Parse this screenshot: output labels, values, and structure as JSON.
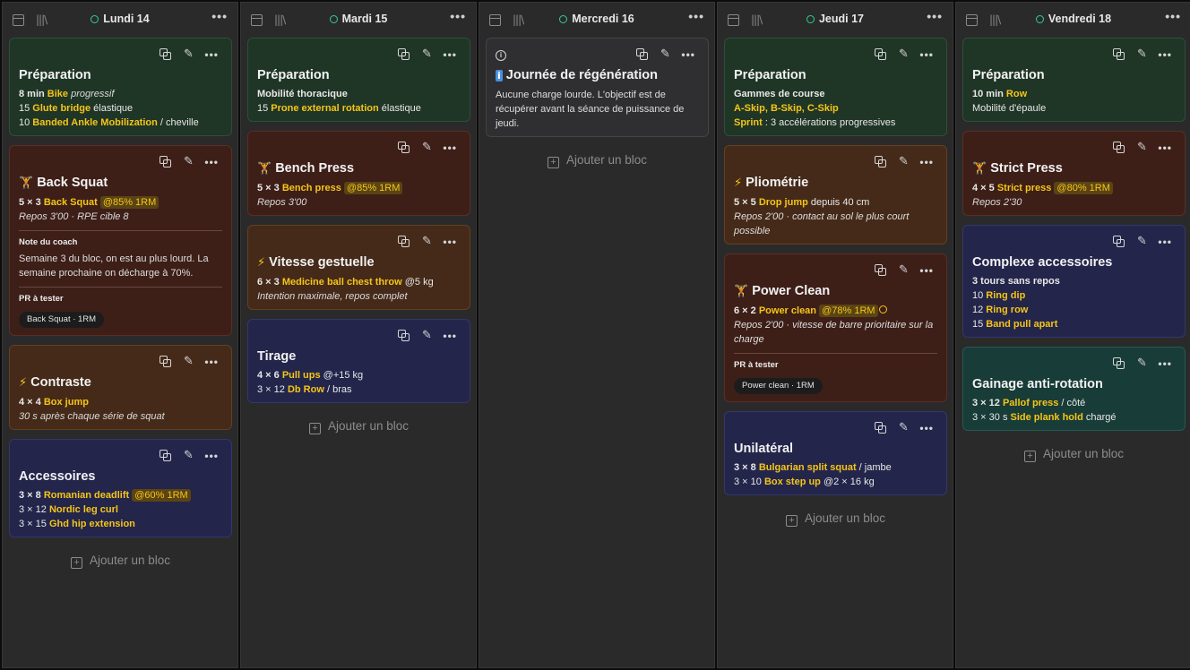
{
  "add_block_label": "Ajouter un bloc",
  "pr_label": "PR à tester",
  "coach_note_label": "Note du coach",
  "colors": {
    "green": "#1f3526",
    "red": "#3d1f18",
    "orange": "#452a19",
    "navy": "#23254b",
    "teal": "#183c37",
    "accent": "#f5c518",
    "status_dot": "#2fd08a"
  },
  "days": [
    {
      "label": "Lundi 14",
      "cards": [
        {
          "color": "green",
          "title": "Préparation",
          "lines": [
            [
              {
                "t": "8 min ",
                "s": "b"
              },
              {
                "t": "Bike",
                "s": "y"
              },
              {
                "t": " "
              },
              {
                "t": "progressif",
                "s": "i"
              }
            ],
            [
              {
                "t": "15 "
              },
              {
                "t": "Glute bridge",
                "s": "y"
              },
              {
                "t": " élastique"
              }
            ],
            [
              {
                "t": "10 "
              },
              {
                "t": "Banded Ankle Mobilization",
                "s": "y"
              },
              {
                "t": " / cheville"
              }
            ]
          ]
        },
        {
          "color": "red",
          "icon": "lift",
          "title": "Back Squat",
          "lines": [
            [
              {
                "t": "5 × 3 ",
                "s": "b"
              },
              {
                "t": "Back Squat",
                "s": "y"
              },
              {
                "t": " "
              },
              {
                "t": "@85% 1RM",
                "s": "tag"
              }
            ],
            [
              {
                "t": "Repos 3'00 · RPE cible 8",
                "s": "i"
              }
            ]
          ],
          "note": "Semaine 3 du bloc, on est au plus lourd. La semaine prochaine on décharge à 70%.",
          "pr": "Back Squat · 1RM"
        },
        {
          "color": "orange",
          "icon": "bolt",
          "title": "Contraste",
          "lines": [
            [
              {
                "t": "4 × 4 ",
                "s": "b"
              },
              {
                "t": "Box jump",
                "s": "y"
              }
            ],
            [
              {
                "t": "30 s après chaque série de squat",
                "s": "i"
              }
            ]
          ]
        },
        {
          "color": "navy",
          "title": "Accessoires",
          "lines": [
            [
              {
                "t": "3 × 8 ",
                "s": "b"
              },
              {
                "t": "Romanian deadlift",
                "s": "y"
              },
              {
                "t": " "
              },
              {
                "t": "@60% 1RM",
                "s": "tag"
              }
            ],
            [
              {
                "t": "3 × 12 "
              },
              {
                "t": "Nordic leg curl",
                "s": "y"
              }
            ],
            [
              {
                "t": "3 × 15 "
              },
              {
                "t": "Ghd hip extension",
                "s": "y"
              }
            ]
          ]
        }
      ]
    },
    {
      "label": "Mardi 15",
      "cards": [
        {
          "color": "green",
          "title": "Préparation",
          "lines": [
            [
              {
                "t": "Mobilité thoracique",
                "s": "b"
              }
            ],
            [
              {
                "t": "15 "
              },
              {
                "t": "Prone external rotation",
                "s": "y"
              },
              {
                "t": " élastique"
              }
            ]
          ]
        },
        {
          "color": "red",
          "icon": "lift",
          "title": "Bench Press",
          "lines": [
            [
              {
                "t": "5 × 3 ",
                "s": "b"
              },
              {
                "t": "Bench press",
                "s": "y"
              },
              {
                "t": " "
              },
              {
                "t": "@85% 1RM",
                "s": "tag"
              }
            ],
            [
              {
                "t": "Repos 3'00",
                "s": "i"
              }
            ]
          ]
        },
        {
          "color": "orange",
          "icon": "bolt",
          "title": "Vitesse gestuelle",
          "lines": [
            [
              {
                "t": "6 × 3 ",
                "s": "b"
              },
              {
                "t": "Medicine ball chest throw",
                "s": "y"
              },
              {
                "t": " @5 kg"
              }
            ],
            [
              {
                "t": "Intention maximale, repos complet",
                "s": "i"
              }
            ]
          ]
        },
        {
          "color": "navy",
          "title": "Tirage",
          "lines": [
            [
              {
                "t": "4 × 6 ",
                "s": "b"
              },
              {
                "t": "Pull ups",
                "s": "y"
              },
              {
                "t": " @+15 kg"
              }
            ],
            [
              {
                "t": "3 × 12 "
              },
              {
                "t": "Db Row",
                "s": "y"
              },
              {
                "t": " / bras"
              }
            ]
          ]
        }
      ]
    },
    {
      "label": "Mercredi 16",
      "cards": [
        {
          "color": "gray",
          "info": true,
          "icon": "info",
          "title": "Journée de régénération",
          "desc": "Aucune charge lourde. L'objectif est de récupérer avant la séance de puissance de jeudi."
        }
      ]
    },
    {
      "label": "Jeudi 17",
      "cards": [
        {
          "color": "green",
          "title": "Préparation",
          "lines": [
            [
              {
                "t": "Gammes de course",
                "s": "b"
              }
            ],
            [
              {
                "t": "A-Skip, B-Skip, C-Skip",
                "s": "y"
              }
            ],
            [
              {
                "t": "Sprint",
                "s": "y"
              },
              {
                "t": " : 3 accélérations progressives"
              }
            ]
          ]
        },
        {
          "color": "orange",
          "icon": "bolt",
          "title": "Pliométrie",
          "lines": [
            [
              {
                "t": "5 × 5 ",
                "s": "b"
              },
              {
                "t": "Drop jump",
                "s": "y"
              },
              {
                "t": " depuis 40 cm"
              }
            ]
          ],
          "desc_i": "Repos 2'00 · contact au sol le plus court possible"
        },
        {
          "color": "red",
          "icon": "lift",
          "title": "Power Clean",
          "lines": [
            [
              {
                "t": "6 × 2 ",
                "s": "b"
              },
              {
                "t": "Power clean",
                "s": "y"
              },
              {
                "t": " "
              },
              {
                "t": "@78% 1RM",
                "s": "tag",
                "warn": true
              }
            ]
          ],
          "desc_i": "Repos 2'00 · vitesse de barre prioritaire sur la charge",
          "pr": "Power clean · 1RM"
        },
        {
          "color": "navy",
          "title": "Unilatéral",
          "lines": [
            [
              {
                "t": "3 × 8 ",
                "s": "b"
              },
              {
                "t": "Bulgarian split squat",
                "s": "y"
              },
              {
                "t": " / jambe"
              }
            ],
            [
              {
                "t": "3 × 10 "
              },
              {
                "t": "Box step up",
                "s": "y"
              },
              {
                "t": " @2 × 16 kg"
              }
            ]
          ]
        }
      ]
    },
    {
      "label": "Vendredi 18",
      "cards": [
        {
          "color": "green",
          "title": "Préparation",
          "lines": [
            [
              {
                "t": "10 min ",
                "s": "b"
              },
              {
                "t": "Row",
                "s": "y"
              }
            ],
            [
              {
                "t": "Mobilité d'épaule"
              }
            ]
          ]
        },
        {
          "color": "red",
          "icon": "lift",
          "title": "Strict Press",
          "lines": [
            [
              {
                "t": "4 × 5 ",
                "s": "b"
              },
              {
                "t": "Strict press",
                "s": "y"
              },
              {
                "t": " "
              },
              {
                "t": "@80% 1RM",
                "s": "tag"
              }
            ],
            [
              {
                "t": "Repos 2'30",
                "s": "i"
              }
            ]
          ]
        },
        {
          "color": "navy",
          "title": "Complexe accessoires",
          "lines": [
            [
              {
                "t": "3 tours sans repos",
                "s": "b"
              }
            ],
            [
              {
                "t": "10 "
              },
              {
                "t": "Ring dip",
                "s": "y"
              }
            ],
            [
              {
                "t": "12 "
              },
              {
                "t": "Ring row",
                "s": "y"
              }
            ],
            [
              {
                "t": "15 "
              },
              {
                "t": "Band pull apart",
                "s": "y"
              }
            ]
          ]
        },
        {
          "color": "teal",
          "title": "Gainage anti-rotation",
          "lines": [
            [
              {
                "t": "3 × 12 ",
                "s": "b"
              },
              {
                "t": "Pallof press",
                "s": "y"
              },
              {
                "t": " / côté"
              }
            ],
            [
              {
                "t": "3 × 30 s "
              },
              {
                "t": "Side plank hold",
                "s": "y"
              },
              {
                "t": " chargé"
              }
            ]
          ]
        }
      ]
    }
  ]
}
